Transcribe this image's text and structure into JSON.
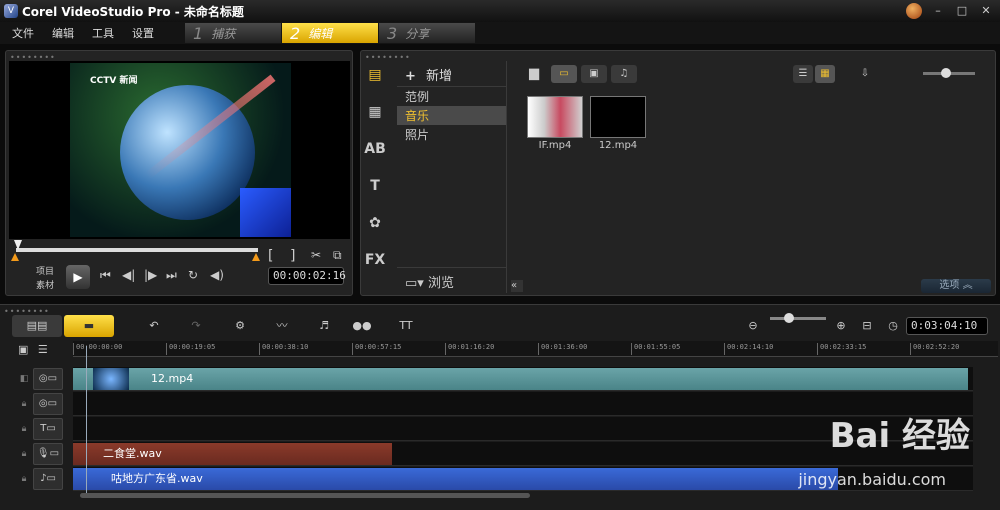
{
  "window": {
    "title": "Corel VideoStudio Pro - 未命名标题"
  },
  "menu": {
    "items": [
      "文件",
      "编辑",
      "工具",
      "设置"
    ]
  },
  "steps": [
    {
      "num": "1",
      "label": "捕获"
    },
    {
      "num": "2",
      "label": "编辑"
    },
    {
      "num": "3",
      "label": "分享"
    }
  ],
  "preview": {
    "mode_project": "项目",
    "mode_clip": "素材",
    "timecode": "00:00:02:16",
    "channel_logo": "CCTV 新闻"
  },
  "library": {
    "add_label": "新增",
    "categories": [
      "范例",
      "音乐",
      "照片"
    ],
    "selected_category": "音乐",
    "browse_label": "浏览",
    "items": [
      {
        "name": "IF.mp4"
      },
      {
        "name": "12.mp4"
      }
    ],
    "options_label": "选项"
  },
  "timeline": {
    "duration": "0:03:04:10",
    "ticks": [
      "00:00:00:00",
      "00:00:19:05",
      "00:00:38:10",
      "00:00:57:15",
      "00:01:16:20",
      "00:01:36:00",
      "00:01:55:05",
      "00:02:14:10",
      "00:02:33:15",
      "00:02:52:20"
    ],
    "video_clip": "12.mp4",
    "voice_clip": "二食堂.wav",
    "music_clip": "咕地方广东省.wav"
  },
  "watermark": {
    "brand": "Bai 经验",
    "url": "jingyan.baidu.com"
  }
}
